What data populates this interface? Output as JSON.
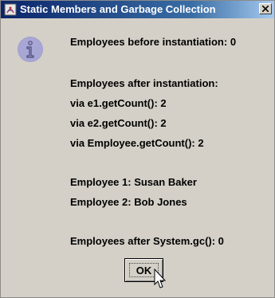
{
  "window": {
    "title": "Static Members and Garbage Collection",
    "title_icon": "java-app-icon",
    "close_icon": "close-icon"
  },
  "dialog": {
    "icon": "info-icon",
    "lines": [
      "Employees before instantiation: 0",
      "Employees after instantiation:",
      "via e1.getCount(): 2",
      "via e2.getCount(): 2",
      "via Employee.getCount(): 2",
      "Employee 1: Susan Baker",
      "Employee 2: Bob Jones",
      "Employees after System.gc(): 0"
    ],
    "ok_label": "OK"
  },
  "colors": {
    "titlebar_start": "#0a246a",
    "titlebar_end": "#a6caf0",
    "dialog_bg": "#d4d0c8",
    "info_icon": "#9f9fcf"
  }
}
